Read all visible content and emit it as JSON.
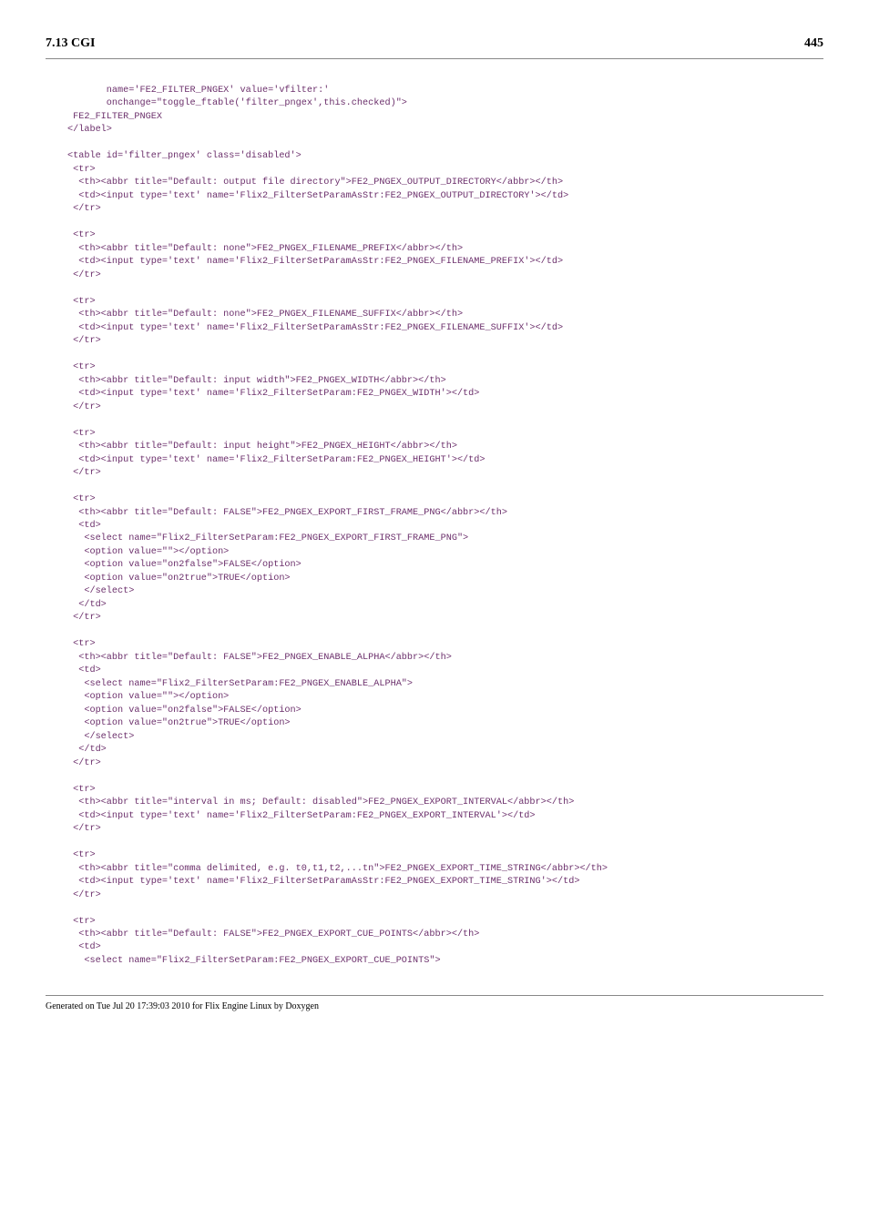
{
  "header": {
    "section": "7.13 CGI",
    "page": "445"
  },
  "code": "       name='FE2_FILTER_PNGEX' value='vfilter:'\n       onchange=\"toggle_ftable('filter_pngex',this.checked)\">\n FE2_FILTER_PNGEX\n</label>\n\n<table id='filter_pngex' class='disabled'>\n <tr>\n  <th><abbr title=\"Default: output file directory\">FE2_PNGEX_OUTPUT_DIRECTORY</abbr></th>\n  <td><input type='text' name='Flix2_FilterSetParamAsStr:FE2_PNGEX_OUTPUT_DIRECTORY'></td>\n </tr>\n\n <tr>\n  <th><abbr title=\"Default: none\">FE2_PNGEX_FILENAME_PREFIX</abbr></th>\n  <td><input type='text' name='Flix2_FilterSetParamAsStr:FE2_PNGEX_FILENAME_PREFIX'></td>\n </tr>\n\n <tr>\n  <th><abbr title=\"Default: none\">FE2_PNGEX_FILENAME_SUFFIX</abbr></th>\n  <td><input type='text' name='Flix2_FilterSetParamAsStr:FE2_PNGEX_FILENAME_SUFFIX'></td>\n </tr>\n\n <tr>\n  <th><abbr title=\"Default: input width\">FE2_PNGEX_WIDTH</abbr></th>\n  <td><input type='text' name='Flix2_FilterSetParam:FE2_PNGEX_WIDTH'></td>\n </tr>\n\n <tr>\n  <th><abbr title=\"Default: input height\">FE2_PNGEX_HEIGHT</abbr></th>\n  <td><input type='text' name='Flix2_FilterSetParam:FE2_PNGEX_HEIGHT'></td>\n </tr>\n\n <tr>\n  <th><abbr title=\"Default: FALSE\">FE2_PNGEX_EXPORT_FIRST_FRAME_PNG</abbr></th>\n  <td>\n   <select name=\"Flix2_FilterSetParam:FE2_PNGEX_EXPORT_FIRST_FRAME_PNG\">\n   <option value=\"\"></option>\n   <option value=\"on2false\">FALSE</option>\n   <option value=\"on2true\">TRUE</option>\n   </select>\n  </td>\n </tr>\n\n <tr>\n  <th><abbr title=\"Default: FALSE\">FE2_PNGEX_ENABLE_ALPHA</abbr></th>\n  <td>\n   <select name=\"Flix2_FilterSetParam:FE2_PNGEX_ENABLE_ALPHA\">\n   <option value=\"\"></option>\n   <option value=\"on2false\">FALSE</option>\n   <option value=\"on2true\">TRUE</option>\n   </select>\n  </td>\n </tr>\n\n <tr>\n  <th><abbr title=\"interval in ms; Default: disabled\">FE2_PNGEX_EXPORT_INTERVAL</abbr></th>\n  <td><input type='text' name='Flix2_FilterSetParam:FE2_PNGEX_EXPORT_INTERVAL'></td>\n </tr>\n\n <tr>\n  <th><abbr title=\"comma delimited, e.g. t0,t1,t2,...tn\">FE2_PNGEX_EXPORT_TIME_STRING</abbr></th>\n  <td><input type='text' name='Flix2_FilterSetParamAsStr:FE2_PNGEX_EXPORT_TIME_STRING'></td>\n </tr>\n\n <tr>\n  <th><abbr title=\"Default: FALSE\">FE2_PNGEX_EXPORT_CUE_POINTS</abbr></th>\n  <td>\n   <select name=\"Flix2_FilterSetParam:FE2_PNGEX_EXPORT_CUE_POINTS\">",
  "footer": "Generated on Tue Jul 20 17:39:03 2010 for Flix Engine Linux by Doxygen"
}
